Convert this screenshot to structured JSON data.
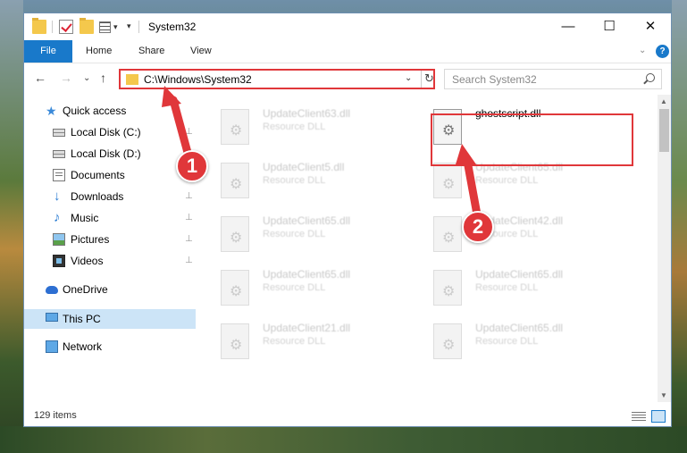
{
  "window": {
    "title": "System32",
    "minimize_glyph": "—",
    "maximize_glyph": "☐",
    "close_glyph": "✕"
  },
  "ribbon": {
    "tabs": [
      {
        "label": "File",
        "active": true
      },
      {
        "label": "Home"
      },
      {
        "label": "Share"
      },
      {
        "label": "View"
      }
    ],
    "help_glyph": "?",
    "collapse_glyph": "⌄"
  },
  "address": {
    "path": "C:\\Windows\\System32",
    "dropdown_glyph": "⌄",
    "refresh_glyph": "↻",
    "search_placeholder": "Search System32"
  },
  "nav_buttons": {
    "back": "←",
    "forward": "→",
    "recent": "⌄",
    "up": "↑"
  },
  "sidebar": {
    "items": [
      {
        "label": "Quick access",
        "icon": "star-icon",
        "pinned": false
      },
      {
        "label": "Local Disk (C:)",
        "icon": "drive-icon",
        "pinned": true
      },
      {
        "label": "Local Disk (D:)",
        "icon": "drive-icon",
        "pinned": false
      },
      {
        "label": "Documents",
        "icon": "documents-icon",
        "pinned": true
      },
      {
        "label": "Downloads",
        "icon": "downloads-icon",
        "pinned": true
      },
      {
        "label": "Music",
        "icon": "music-icon",
        "pinned": true
      },
      {
        "label": "Pictures",
        "icon": "pictures-icon",
        "pinned": true
      },
      {
        "label": "Videos",
        "icon": "videos-icon",
        "pinned": true
      },
      {
        "label": "OneDrive",
        "icon": "onedrive-icon",
        "pinned": false
      },
      {
        "label": "This PC",
        "icon": "this-pc-icon",
        "pinned": false,
        "selected": true
      },
      {
        "label": "Network",
        "icon": "network-icon",
        "pinned": false
      }
    ],
    "pin_glyph": "📌"
  },
  "files": [
    {
      "name": "UpdateClient63.dll",
      "type": "Resource DLL"
    },
    {
      "name": "ghostscript.dll",
      "type": ""
    },
    {
      "name": "UpdateClient5.dll",
      "type": "Resource DLL"
    },
    {
      "name": "UpdateClient65.dll",
      "type": "Resource DLL"
    },
    {
      "name": "UpdateClient65.dll",
      "type": "Resource DLL"
    },
    {
      "name": "UpdateClient42.dll",
      "type": "Resource DLL"
    },
    {
      "name": "UpdateClient65.dll",
      "type": "Resource DLL"
    },
    {
      "name": "UpdateClient65.dll",
      "type": "Resource DLL"
    },
    {
      "name": "UpdateClient21.dll",
      "type": "Resource DLL"
    },
    {
      "name": "UpdateClient65.dll",
      "type": "Resource DLL"
    }
  ],
  "status": {
    "item_count": "129 items"
  },
  "annotations": {
    "step1": "1",
    "step2": "2"
  },
  "colors": {
    "accent": "#1979ca",
    "highlight_red": "#e0373a",
    "selected_bg": "#cce4f7"
  }
}
